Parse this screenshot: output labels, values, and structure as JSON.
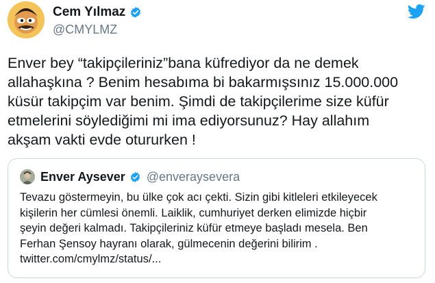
{
  "tweet": {
    "author": {
      "name": "Cem Yılmaz",
      "handle": "@CMYLMZ",
      "verified_icon": "verified-badge-icon"
    },
    "brand_icon": "twitter-bird-icon",
    "text": "Enver bey “takipçileriniz”bana küfrediyor da ne demek\nallahaşkına ? Benim hesabıma bi bakarmışsınız 15.000.000\nküsür takipçim var benim. Şimdi de takipçilerime size küfür\netmelerini söylediğimi mi ima ediyorsunuz? Hay allahım\nakşam vakti evde otururken !"
  },
  "quote": {
    "author": {
      "name": "Enver Aysever",
      "handle": "@enveraysevera",
      "verified_icon": "verified-badge-icon"
    },
    "text": "Tevazu göstermeyin, bu ülke çok acı çekti. Sizin gibi kitleleri etkileyecek\nkişilerin her cümlesi önemli. Laiklik, cumhuriyet derken elimizde hiçbir\nşeyin değeri kalmadı. Takipçileriniz küfür etmeye başladı mesela. Ben\nFerhan Şensoy hayranı olarak, gülmecenin değerini bilirim .\ntwitter.com/cmylmz/status/..."
  },
  "colors": {
    "verified": "#1da1f2",
    "twitter_blue": "#1da1f2",
    "secondary_text": "#657786",
    "border": "#ccd6dd"
  }
}
